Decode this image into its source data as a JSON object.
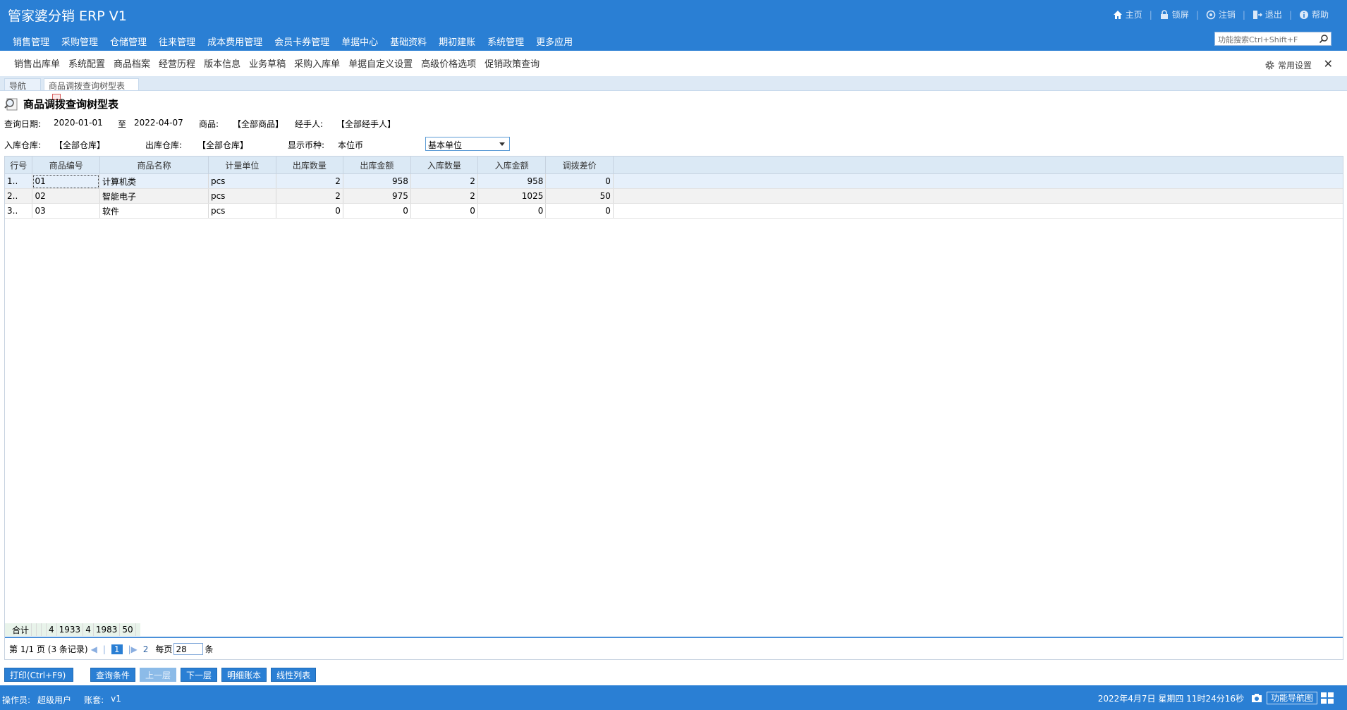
{
  "app": {
    "title": "管家婆分销 ERP V1"
  },
  "top_links": [
    {
      "label": "主页",
      "icon": "home-icon"
    },
    {
      "label": "锁屏",
      "icon": "lock-icon"
    },
    {
      "label": "注销",
      "icon": "logout-circle-icon"
    },
    {
      "label": "退出",
      "icon": "exit-icon"
    },
    {
      "label": "帮助",
      "icon": "help-icon"
    }
  ],
  "main_nav": [
    "销售管理",
    "采购管理",
    "仓储管理",
    "往来管理",
    "成本费用管理",
    "会员卡券管理",
    "单据中心",
    "基础资料",
    "期初建账",
    "系统管理",
    "更多应用"
  ],
  "func_search": {
    "placeholder": "功能搜索Ctrl+Shift+F"
  },
  "quick_links": [
    "销售出库单",
    "系统配置",
    "商品档案",
    "经营历程",
    "版本信息",
    "业务草稿",
    "采购入库单",
    "单据自定义设置",
    "高级价格选项",
    "促销政策查询"
  ],
  "common_settings": "常用设置",
  "close_label": "✕",
  "tabs": {
    "nav": "导航",
    "active": "商品调拨查询树型表"
  },
  "page": {
    "title": "商品调拨查询树型表"
  },
  "filters": {
    "date_label": "查询日期:",
    "date_from": "2020-01-01",
    "date_to_label": "至",
    "date_to": "2022-04-07",
    "goods_label": "商品:",
    "goods_value": "【全部商品】",
    "handler_label": "经手人:",
    "handler_value": "【全部经手人】",
    "in_wh_label": "入库仓库:",
    "in_wh_value": "【全部仓库】",
    "out_wh_label": "出库仓库:",
    "out_wh_value": "【全部仓库】",
    "currency_label": "显示币种:",
    "currency_value": "本位币",
    "unit_value": "基本单位"
  },
  "table": {
    "columns": [
      "行号",
      "商品编号",
      "商品名称",
      "计量单位",
      "出库数量",
      "出库金额",
      "入库数量",
      "入库金额",
      "调拨差价"
    ],
    "rows": [
      [
        "1..",
        "01",
        "计算机类",
        "pcs",
        "2",
        "958",
        "2",
        "958",
        "0"
      ],
      [
        "2..",
        "02",
        "智能电子",
        "pcs",
        "2",
        "975",
        "2",
        "1025",
        "50"
      ],
      [
        "3..",
        "03",
        "软件",
        "pcs",
        "0",
        "0",
        "0",
        "0",
        "0"
      ]
    ],
    "total": {
      "label": "合计",
      "out_qty": "4",
      "out_amt": "1933",
      "in_qty": "4",
      "in_amt": "1983",
      "diff": "50"
    }
  },
  "pager": {
    "page_text": "第 1/1 页 (3 条记录)",
    "current": "1",
    "next_page": "2",
    "per_page_label": "每页",
    "per_page": "28",
    "unit": "条"
  },
  "actions": [
    {
      "label": "打印(Ctrl+F9)",
      "disabled": false
    },
    {
      "label": "查询条件",
      "disabled": false
    },
    {
      "label": "上一层",
      "disabled": true
    },
    {
      "label": "下一层",
      "disabled": false
    },
    {
      "label": "明细账本",
      "disabled": false
    },
    {
      "label": "线性列表",
      "disabled": false
    }
  ],
  "status": {
    "operator_label": "操作员:",
    "operator": "超级用户",
    "account_label": "账套:",
    "account": "v1",
    "datetime": "2022年4月7日  星期四  11时24分16秒",
    "navmap": "功能导航图"
  },
  "colors": {
    "primary": "#2a7fd4",
    "header_row": "#dbe9f5",
    "total_row": "#e8f3ea"
  }
}
